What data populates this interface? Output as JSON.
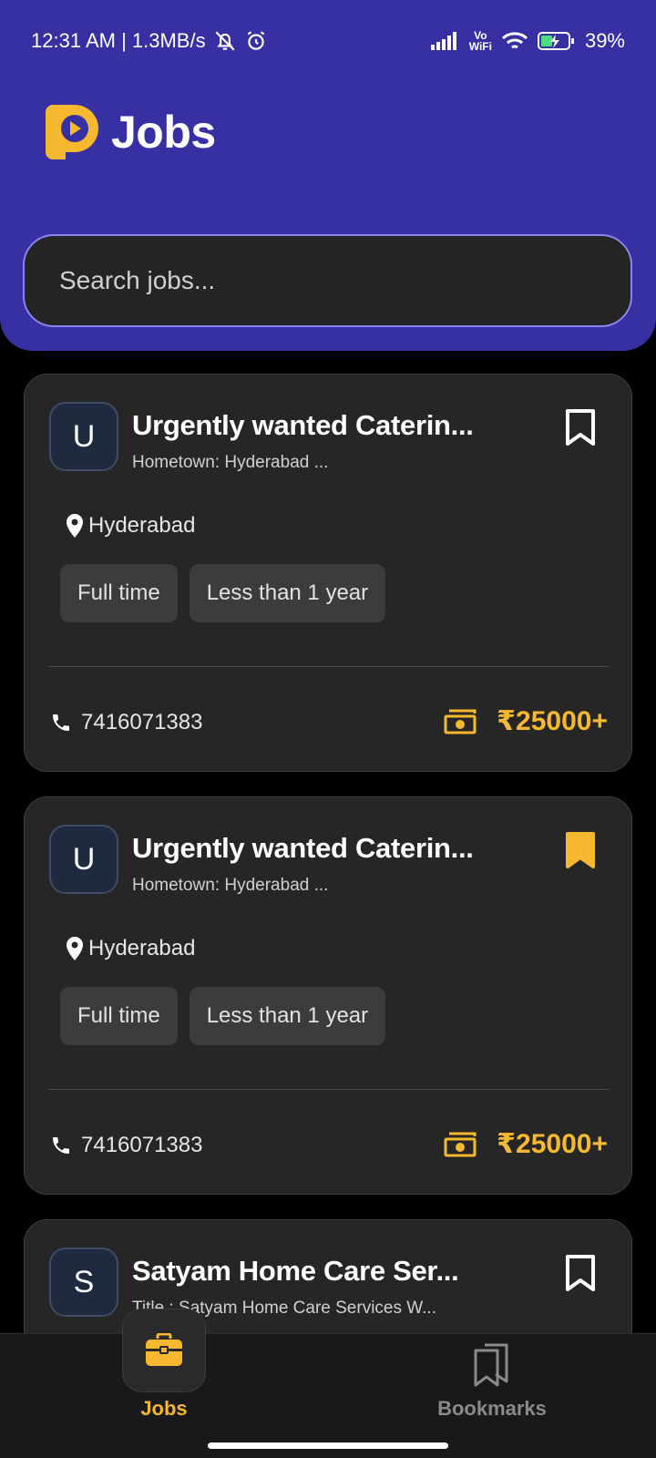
{
  "status_bar": {
    "time_speed": "12:31 AM | 1.3MB/s",
    "vowifi_top": "Vo",
    "vowifi_bottom": "WiFi",
    "battery": "39%"
  },
  "header": {
    "title": "Jobs",
    "brand_color": "#f5b82e",
    "background_color": "#3730a3"
  },
  "search": {
    "placeholder": "Search jobs..."
  },
  "jobs": [
    {
      "avatar_letter": "U",
      "title": "Urgently wanted Caterin...",
      "subtitle": "Hometown: Hyderabad ...",
      "bookmarked": false,
      "location": "Hyderabad",
      "tags": [
        "Full time",
        "Less than 1 year"
      ],
      "phone": "7416071383",
      "salary": "₹25000+"
    },
    {
      "avatar_letter": "U",
      "title": "Urgently wanted Caterin...",
      "subtitle": "Hometown: Hyderabad ...",
      "bookmarked": true,
      "location": "Hyderabad",
      "tags": [
        "Full time",
        "Less than 1 year"
      ],
      "phone": "7416071383",
      "salary": "₹25000+"
    },
    {
      "avatar_letter": "S",
      "title": "Satyam Home Care Ser...",
      "subtitle": "Title : Satyam Home Care Services W...",
      "bookmarked": false
    }
  ],
  "bottom_nav": {
    "jobs_label": "Jobs",
    "bookmarks_label": "Bookmarks",
    "active_color": "#f5b82e",
    "inactive_color": "#8a8a8a"
  }
}
